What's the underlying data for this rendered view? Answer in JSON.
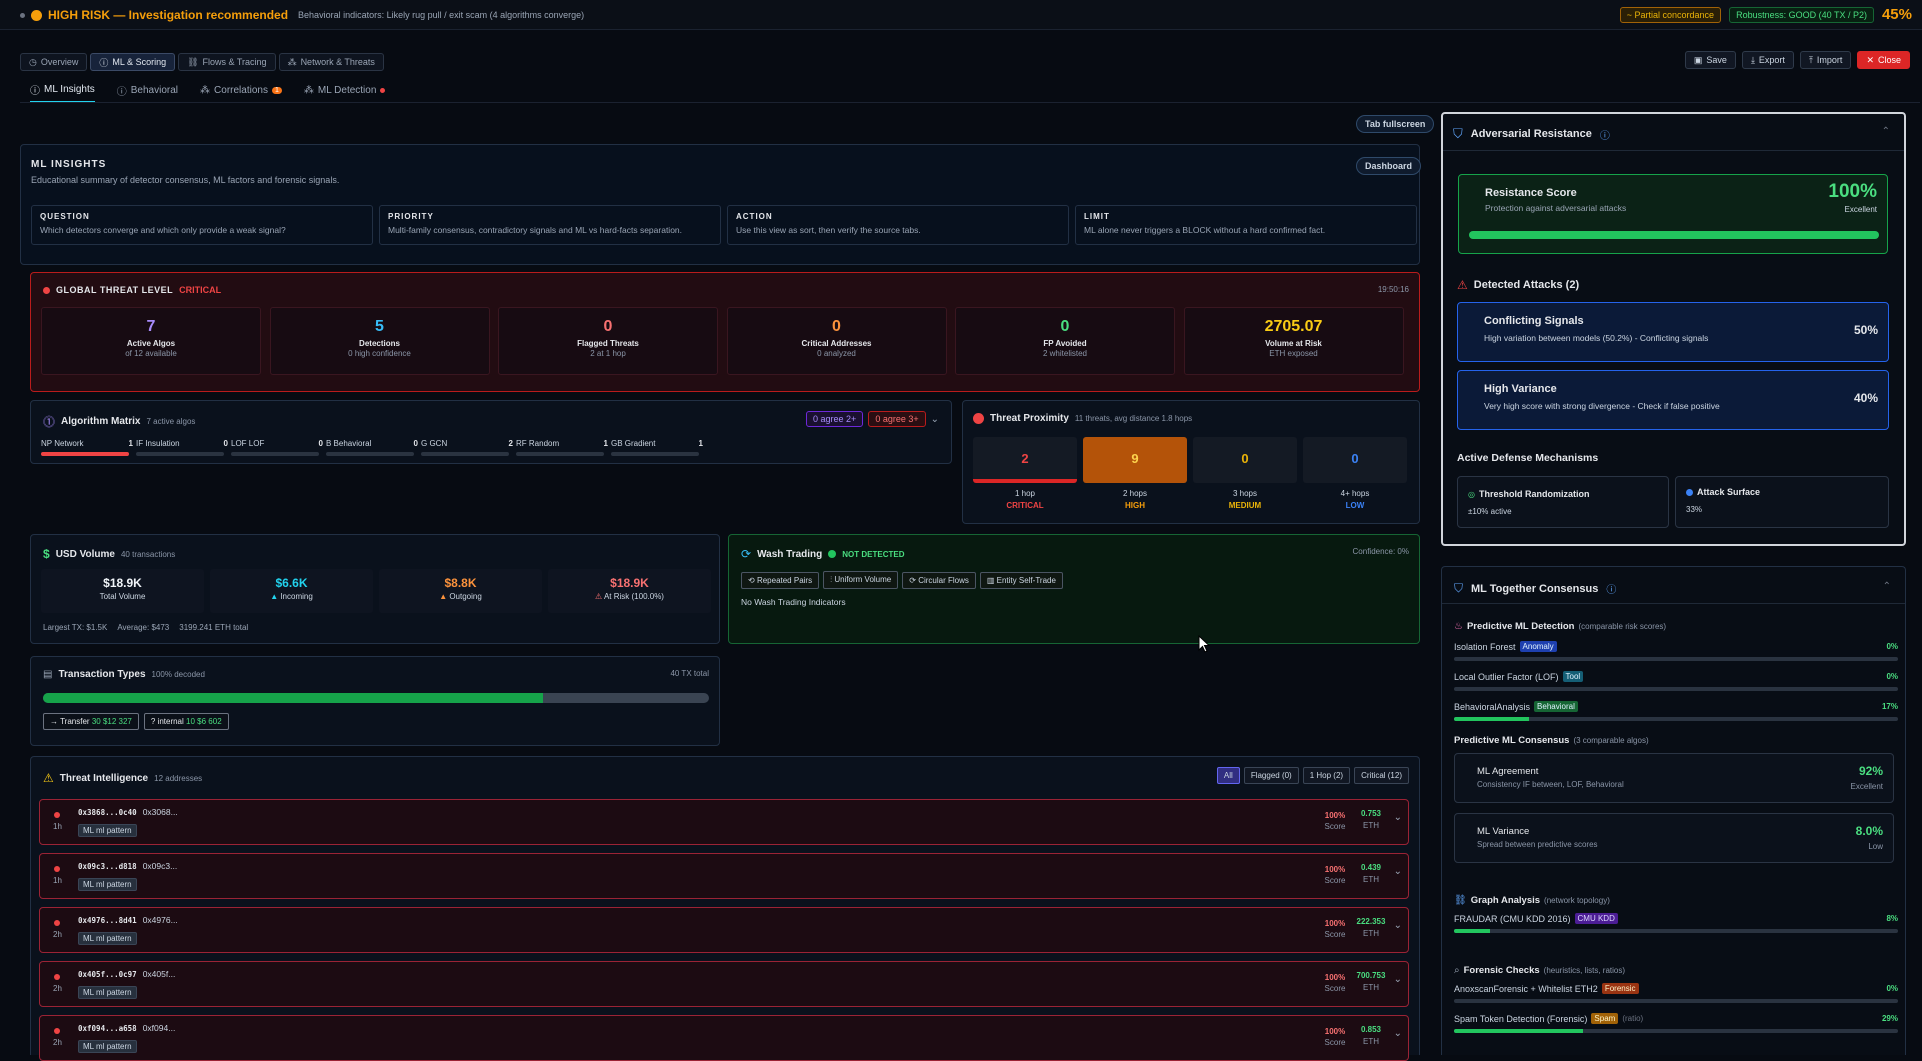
{
  "header": {
    "risk_label": "HIGH RISK — Investigation recommended",
    "risk_desc": "Behavioral indicators: Likely rug pull / exit scam (4 algorithms converge)",
    "concordance": "~ Partial concordance",
    "robustness": "Robustness: GOOD (40 TX / P2)",
    "percent": "45%"
  },
  "tabs": [
    "Overview",
    "ML & Scoring",
    "Flows & Tracing",
    "Network & Threats"
  ],
  "actions": {
    "save": "Save",
    "export": "Export",
    "import": "Import",
    "close": "Close"
  },
  "subtabs": [
    "ML Insights",
    "Behavioral",
    "Correlations",
    "ML Detection"
  ],
  "correlations_badge": "1",
  "tab_fullscreen": "Tab fullscreen",
  "insights": {
    "title": "ML INSIGHTS",
    "desc": "Educational summary of detector consensus, ML factors and forensic signals.",
    "dashboard": "Dashboard",
    "boxes": [
      {
        "h": "QUESTION",
        "t": "Which detectors converge and which only provide a weak signal?"
      },
      {
        "h": "PRIORITY",
        "t": "Multi-family consensus, contradictory signals and ML vs hard-facts separation."
      },
      {
        "h": "ACTION",
        "t": "Use this view as sort, then verify the source tabs."
      },
      {
        "h": "LIMIT",
        "t": "ML alone never triggers a BLOCK without a hard confirmed fact."
      }
    ]
  },
  "threat": {
    "label": "GLOBAL THREAT LEVEL",
    "level": "CRITICAL",
    "time": "19:50:16",
    "stats": [
      {
        "v": "7",
        "t": "Active Algos",
        "s": "of 12 available",
        "c": "#a78bfa"
      },
      {
        "v": "5",
        "t": "Detections",
        "s": "0 high confidence",
        "c": "#38bdf8"
      },
      {
        "v": "0",
        "t": "Flagged Threats",
        "s": "2 at 1 hop",
        "c": "#f87171"
      },
      {
        "v": "0",
        "t": "Critical Addresses",
        "s": "0 analyzed",
        "c": "#fb923c"
      },
      {
        "v": "0",
        "t": "FP Avoided",
        "s": "2 whitelisted",
        "c": "#4ade80"
      },
      {
        "v": "2705.07",
        "t": "Volume at Risk",
        "s": "ETH exposed",
        "c": "#facc15"
      }
    ]
  },
  "algo": {
    "title": "Algorithm Matrix",
    "sub": "7 active algos",
    "agree2": "0 agree 2+",
    "agree3": "0 agree 3+",
    "items": [
      {
        "n": "NP Network",
        "v": "1",
        "f": 1
      },
      {
        "n": "IF Insulation",
        "v": "0",
        "f": 0
      },
      {
        "n": "LOF LOF",
        "v": "0",
        "f": 0
      },
      {
        "n": "B Behavioral",
        "v": "0",
        "f": 0
      },
      {
        "n": "G GCN",
        "v": "2",
        "f": 0
      },
      {
        "n": "RF Random",
        "v": "1",
        "f": 0
      },
      {
        "n": "GB Gradient",
        "v": "1",
        "f": 0
      }
    ]
  },
  "proximity": {
    "title": "Threat Proximity",
    "sub": "11 threats, avg distance 1.8 hops",
    "cells": [
      {
        "v": "2",
        "h": "1 hop",
        "l": "CRITICAL",
        "c": "#ef4444"
      },
      {
        "v": "9",
        "h": "2 hops",
        "l": "HIGH",
        "c": "#f59e0b"
      },
      {
        "v": "0",
        "h": "3 hops",
        "l": "MEDIUM",
        "c": "#eab308"
      },
      {
        "v": "0",
        "h": "4+ hops",
        "l": "LOW",
        "c": "#3b82f6"
      }
    ]
  },
  "usd": {
    "title": "USD Volume",
    "sub": "40 transactions",
    "cells": [
      {
        "v": "$18.9K",
        "l": "Total Volume",
        "c": "#f1f5f9"
      },
      {
        "v": "$6.6K",
        "l": "Incoming",
        "c": "#22d3ee"
      },
      {
        "v": "$8.8K",
        "l": "Outgoing",
        "c": "#fb923c"
      },
      {
        "v": "$18.9K",
        "l": "At Risk (100.0%)",
        "c": "#f87171"
      }
    ],
    "footer": [
      "Largest TX: $1.5K",
      "Average: $473",
      "3199.241 ETH total"
    ]
  },
  "wash": {
    "title": "Wash Trading",
    "status": "NOT DETECTED",
    "confidence": "Confidence: 0%",
    "chips": [
      "Repeated Pairs",
      "Uniform Volume",
      "Circular Flows",
      "Entity Self-Trade"
    ],
    "note": "No Wash Trading Indicators"
  },
  "txtypes": {
    "title": "Transaction Types",
    "sub": "100% decoded",
    "total": "40 TX total",
    "fill": 0.75,
    "chips": [
      {
        "p": "→ Transfer",
        "n": "30",
        "v": "$12 327"
      },
      {
        "p": "? internal",
        "n": "10",
        "v": "$6 602"
      }
    ]
  },
  "ti": {
    "title": "Threat Intelligence",
    "sub": "12 addresses",
    "filters": [
      "All",
      "Flagged (0)",
      "1 Hop (2)",
      "Critical (12)"
    ],
    "items": [
      {
        "hop": "1h",
        "a": "0x3868...0c40",
        "b": "0x3068...",
        "score": "100%",
        "eth": "0.753"
      },
      {
        "hop": "1h",
        "a": "0x09c3...d818",
        "b": "0x09c3...",
        "score": "100%",
        "eth": "0.439"
      },
      {
        "hop": "2h",
        "a": "0x4976...8d41",
        "b": "0x4976...",
        "score": "100%",
        "eth": "222.353"
      },
      {
        "hop": "2h",
        "a": "0x405f...0c97",
        "b": "0x405f...",
        "score": "100%",
        "eth": "700.753"
      },
      {
        "hop": "2h",
        "a": "0xf094...a658",
        "b": "0xf094...",
        "score": "100%",
        "eth": "0.853"
      }
    ],
    "tag": "ML ml pattern",
    "score_lbl": "Score",
    "eth_lbl": "ETH"
  },
  "adv": {
    "title": "Adversarial Resistance",
    "score_title": "Resistance Score",
    "score_sub": "Protection against adversarial attacks",
    "score": "100%",
    "score_lbl": "Excellent",
    "fill": 1.0,
    "attacks_title": "Detected Attacks (2)",
    "attacks": [
      {
        "t": "Conflicting Signals",
        "d": "High variation between models (50.2%) - Conflicting signals",
        "v": "50%"
      },
      {
        "t": "High Variance",
        "d": "Very high score with strong divergence - Check if false positive",
        "v": "40%"
      }
    ],
    "defense_title": "Active Defense Mechanisms",
    "defense": [
      {
        "t": "Threshold Randomization",
        "s": "±10% active"
      },
      {
        "t": "Attack Surface",
        "s": "33%"
      }
    ]
  },
  "cons": {
    "title": "ML Together Consensus",
    "pred_title": "Predictive ML Detection",
    "pred_sub": "(comparable risk scores)",
    "pred": [
      {
        "n": "Isolation Forest",
        "b": "Anomaly",
        "v": "0%",
        "f": 0.0
      },
      {
        "n": "Local Outlier Factor (LOF)",
        "b": "Tool",
        "v": "0%",
        "f": 0.0
      },
      {
        "n": "BehavioralAnalysis",
        "b": "Behavioral",
        "v": "17%",
        "f": 0.17
      }
    ],
    "pc_title": "Predictive ML Consensus",
    "pc_sub": "(3 comparable algos)",
    "agree": {
      "t": "ML Agreement",
      "s": "Consistency IF between, LOF, Behavioral",
      "v": "92%",
      "l": "Excellent"
    },
    "variance": {
      "t": "ML Variance",
      "s": "Spread between predictive scores",
      "v": "8.0%",
      "l": "Low"
    },
    "graph_title": "Graph Analysis",
    "graph_sub": "(network topology)",
    "graph": {
      "n": "FRAUDAR (CMU KDD 2016)",
      "b": "CMU KDD",
      "v": "8%",
      "f": 0.08
    },
    "for_title": "Forensic Checks",
    "for_sub": "(heuristics, lists, ratios)",
    "forensic": [
      {
        "n": "AnoxscanForensic + Whitelist ETH2",
        "b": "Forensic",
        "v": "0%",
        "f": 0.0
      },
      {
        "n": "Spam Token Detection (Forensic)",
        "b": "Spam",
        "extra": "(ratio)",
        "v": "29%",
        "f": 0.29
      }
    ]
  }
}
